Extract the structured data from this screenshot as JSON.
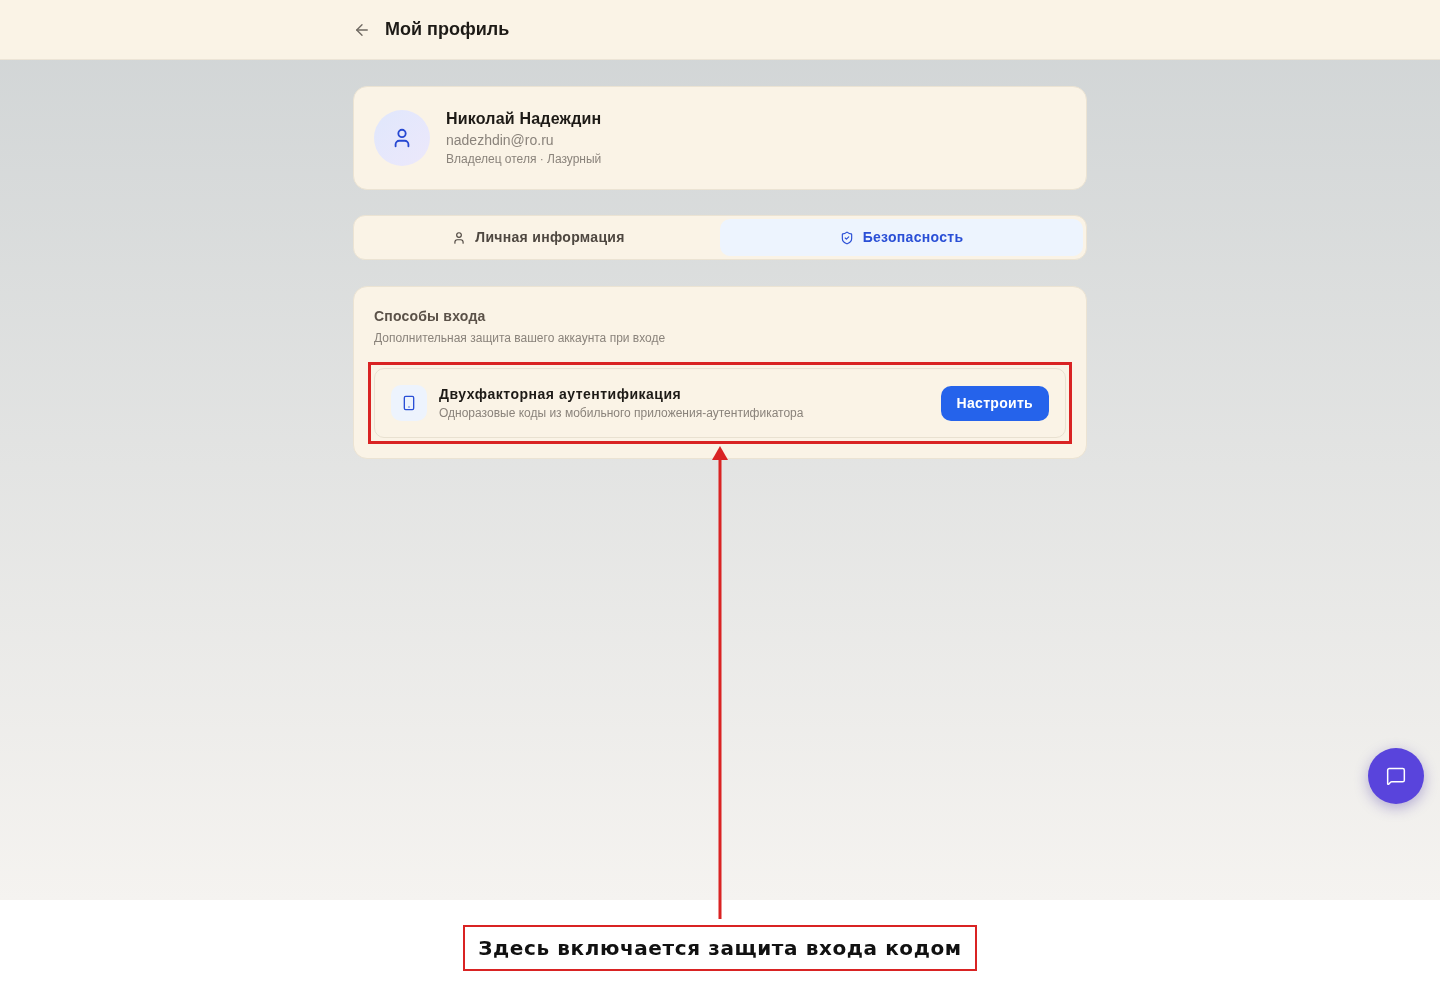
{
  "header": {
    "title": "Мой профиль"
  },
  "profile": {
    "name": "Николай Надеждин",
    "email": "nadezhdin@ro.ru",
    "role": "Владелец отеля · Лазурный"
  },
  "tabs": [
    {
      "label": "Личная информация",
      "selected": false
    },
    {
      "label": "Безопасность",
      "selected": true
    }
  ],
  "login_methods": {
    "title": "Способы входа",
    "subtitle": "Дополнительная защита вашего аккаунта при входе",
    "items": [
      {
        "title": "Двухфакторная аутентификация",
        "description": "Одноразовые коды из мобильного приложения-аутентификатора",
        "button": "Настроить",
        "highlighted": true
      }
    ]
  },
  "annotation": {
    "caption": "Здесь включается защита входа кодом"
  }
}
